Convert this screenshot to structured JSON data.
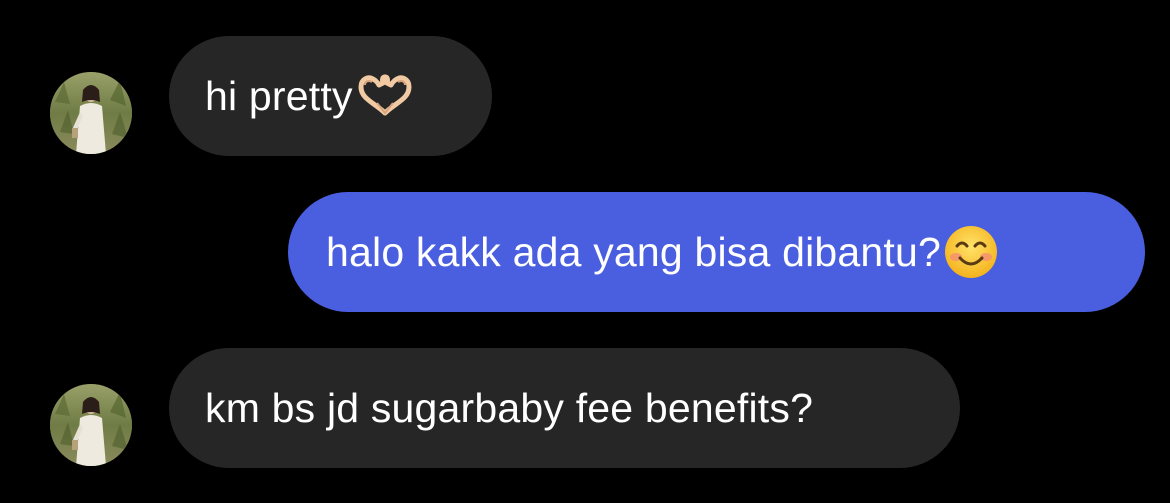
{
  "conversation": {
    "messages": [
      {
        "sender": "other",
        "text": "hi pretty",
        "emoji": "heart-hands-emoji",
        "bubble_color": "#262626"
      },
      {
        "sender": "me",
        "text": "halo kakk ada yang bisa dibantu?",
        "emoji": "smiling-face-emoji",
        "bubble_color": "#4a5ee0"
      },
      {
        "sender": "other",
        "text": "km bs jd sugarbaby fee benefits?",
        "emoji": "",
        "bubble_color": "#262626"
      }
    ]
  },
  "theme": {
    "background": "#000000",
    "text_color": "#ffffff"
  }
}
